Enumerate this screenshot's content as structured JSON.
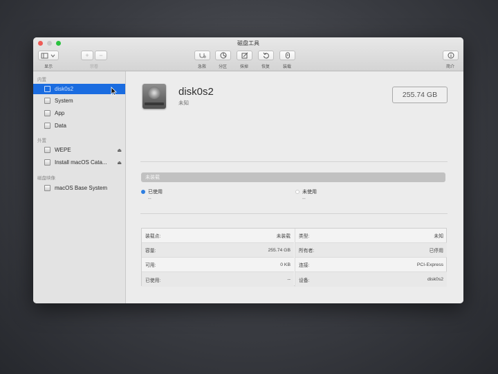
{
  "window": {
    "title": "磁盘工具"
  },
  "toolbar": {
    "view_label": "显示",
    "volume_label": "宗卷",
    "add_symbol": "+",
    "remove_symbol": "−",
    "firstaid_label": "急救",
    "partition_label": "分区",
    "erase_label": "抹掉",
    "restore_label": "恢复",
    "mount_label": "装载",
    "info_label": "简介"
  },
  "sidebar": {
    "internal_label": "内置",
    "external_label": "外置",
    "images_label": "磁盘映像",
    "internal_items": [
      {
        "label": "disk0s2",
        "selected": true
      },
      {
        "label": "System"
      },
      {
        "label": "App"
      },
      {
        "label": "Data"
      }
    ],
    "external_items": [
      {
        "label": "WEPE",
        "eject": "⏏"
      },
      {
        "label": "Install macOS Cata...",
        "eject": "⏏"
      }
    ],
    "image_items": [
      {
        "label": "macOS Base System"
      }
    ]
  },
  "disk": {
    "name": "disk0s2",
    "subtitle": "未知",
    "capacity_display": "255.74 GB"
  },
  "usage": {
    "bar_label": "未装载",
    "used_label": "已使用",
    "used_value": "--",
    "used_color": "#2e7fe0",
    "free_label": "未使用",
    "free_value": "--",
    "free_color": "#ffffff"
  },
  "info": {
    "left": [
      {
        "key": "装载点:",
        "value": "未装载"
      },
      {
        "key": "容量:",
        "value": "255.74 GB"
      },
      {
        "key": "可用:",
        "value": "0 KB"
      },
      {
        "key": "已使用:",
        "value": "--"
      }
    ],
    "right": [
      {
        "key": "类型:",
        "value": "未知"
      },
      {
        "key": "所有者:",
        "value": "已停用"
      },
      {
        "key": "连接:",
        "value": "PCI-Express"
      },
      {
        "key": "设备:",
        "value": "disk0s2"
      }
    ]
  },
  "colors": {
    "accent": "#1a6ce0",
    "close": "#ee5b56",
    "maximize": "#2bc23f"
  }
}
